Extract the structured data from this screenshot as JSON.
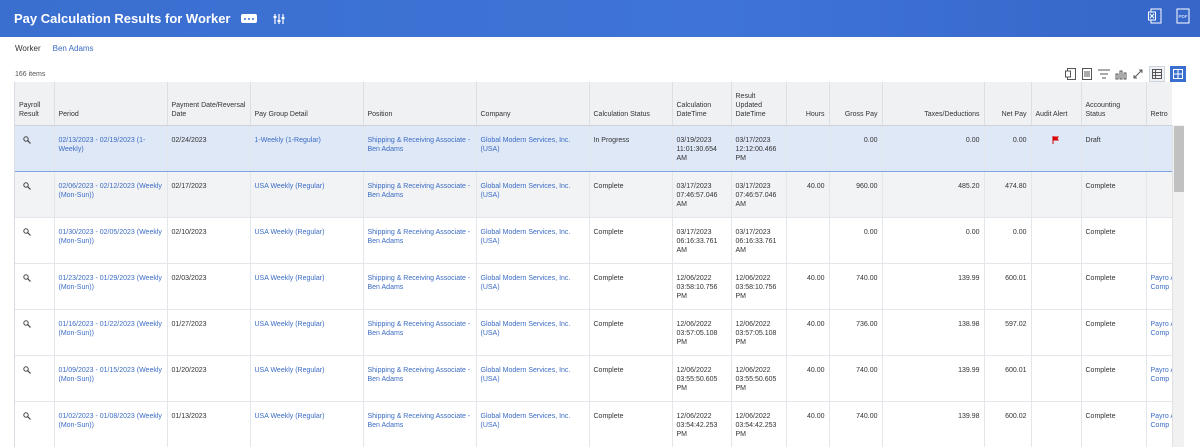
{
  "header": {
    "title": "Pay Calculation Results for Worker",
    "more_icon": "ellipsis-icon",
    "config_icon": "related-actions-sliders-icon",
    "right_icons": [
      "excel-export-icon",
      "pdf-export-icon"
    ],
    "pdf_label": "PDF",
    "color": "#3a6fd0"
  },
  "worker": {
    "label": "Worker",
    "value": "Ben Adams"
  },
  "items_count": "166 items",
  "columns": [
    "Payroll Result",
    "Period",
    "Payment Date/Reversal Date",
    "Pay Group Detail",
    "Position",
    "Company",
    "Calculation Status",
    "Calculation DateTime",
    "Result Updated DateTime",
    "Hours",
    "Gross Pay",
    "Taxes/Deductions",
    "Net Pay",
    "Audit Alert",
    "Accounting Status",
    "Retro"
  ],
  "rows": [
    {
      "period": "02/13/2023 - 02/19/2023 (1-Weekly)",
      "payment_date": "02/24/2023",
      "pay_group": "1-Weekly (1-Regular)",
      "position": "Shipping & Receiving Associate - Ben Adams",
      "company": "Global Modern Services, Inc. (USA)",
      "calc_status": "In Progress",
      "calc_dt": "03/19/2023 11:01:30.654 AM",
      "updated_dt": "03/17/2023 12:12:00.466 PM",
      "hours": "",
      "gross": "0.00",
      "taxes": "0.00",
      "net": "0.00",
      "audit_alert": true,
      "acct_status": "Draft",
      "retro": ""
    },
    {
      "period": "02/06/2023 - 02/12/2023 (Weekly (Mon-Sun))",
      "payment_date": "02/17/2023",
      "pay_group": "USA Weekly (Regular)",
      "position": "Shipping & Receiving Associate - Ben Adams",
      "company": "Global Modern Services, Inc. (USA)",
      "calc_status": "Complete",
      "calc_dt": "03/17/2023 07:46:57.046 AM",
      "updated_dt": "03/17/2023 07:46:57.046 AM",
      "hours": "40.00",
      "gross": "960.00",
      "taxes": "485.20",
      "net": "474.80",
      "audit_alert": false,
      "acct_status": "Complete",
      "retro": ""
    },
    {
      "period": "01/30/2023 - 02/05/2023 (Weekly (Mon-Sun))",
      "payment_date": "02/10/2023",
      "pay_group": "USA Weekly (Regular)",
      "position": "Shipping & Receiving Associate - Ben Adams",
      "company": "Global Modern Services, Inc. (USA)",
      "calc_status": "Complete",
      "calc_dt": "03/17/2023 06:16:33.761 AM",
      "updated_dt": "03/17/2023 06:16:33.761 AM",
      "hours": "",
      "gross": "0.00",
      "taxes": "0.00",
      "net": "0.00",
      "audit_alert": false,
      "acct_status": "Complete",
      "retro": ""
    },
    {
      "period": "01/23/2023 - 01/29/2023 (Weekly (Mon-Sun))",
      "payment_date": "02/03/2023",
      "pay_group": "USA Weekly (Regular)",
      "position": "Shipping & Receiving Associate - Ben Adams",
      "company": "Global Modern Services, Inc. (USA)",
      "calc_status": "Complete",
      "calc_dt": "12/06/2022 03:58:10.756 PM",
      "updated_dt": "12/06/2022 03:58:10.756 PM",
      "hours": "40.00",
      "gross": "740.00",
      "taxes": "139.99",
      "net": "600.01",
      "audit_alert": false,
      "acct_status": "Complete",
      "retro": "Payro Adam Comp"
    },
    {
      "period": "01/16/2023 - 01/22/2023 (Weekly (Mon-Sun))",
      "payment_date": "01/27/2023",
      "pay_group": "USA Weekly (Regular)",
      "position": "Shipping & Receiving Associate - Ben Adams",
      "company": "Global Modern Services, Inc. (USA)",
      "calc_status": "Complete",
      "calc_dt": "12/06/2022 03:57:05.108 PM",
      "updated_dt": "12/06/2022 03:57:05.108 PM",
      "hours": "40.00",
      "gross": "736.00",
      "taxes": "138.98",
      "net": "597.02",
      "audit_alert": false,
      "acct_status": "Complete",
      "retro": "Payro Adam Comp"
    },
    {
      "period": "01/09/2023 - 01/15/2023 (Weekly (Mon-Sun))",
      "payment_date": "01/20/2023",
      "pay_group": "USA Weekly (Regular)",
      "position": "Shipping & Receiving Associate - Ben Adams",
      "company": "Global Modern Services, Inc. (USA)",
      "calc_status": "Complete",
      "calc_dt": "12/06/2022 03:55:50.605 PM",
      "updated_dt": "12/06/2022 03:55:50.605 PM",
      "hours": "40.00",
      "gross": "740.00",
      "taxes": "139.99",
      "net": "600.01",
      "audit_alert": false,
      "acct_status": "Complete",
      "retro": "Payro Adam Comp"
    },
    {
      "period": "01/02/2023 - 01/08/2023 (Weekly (Mon-Sun))",
      "payment_date": "01/13/2023",
      "pay_group": "USA Weekly (Regular)",
      "position": "Shipping & Receiving Associate - Ben Adams",
      "company": "Global Modern Services, Inc. (USA)",
      "calc_status": "Complete",
      "calc_dt": "12/06/2022 03:54:42.253 PM",
      "updated_dt": "12/06/2022 03:54:42.253 PM",
      "hours": "40.00",
      "gross": "740.00",
      "taxes": "139.98",
      "net": "600.02",
      "audit_alert": false,
      "acct_status": "Complete",
      "retro": "Payro Adam Comp"
    }
  ]
}
